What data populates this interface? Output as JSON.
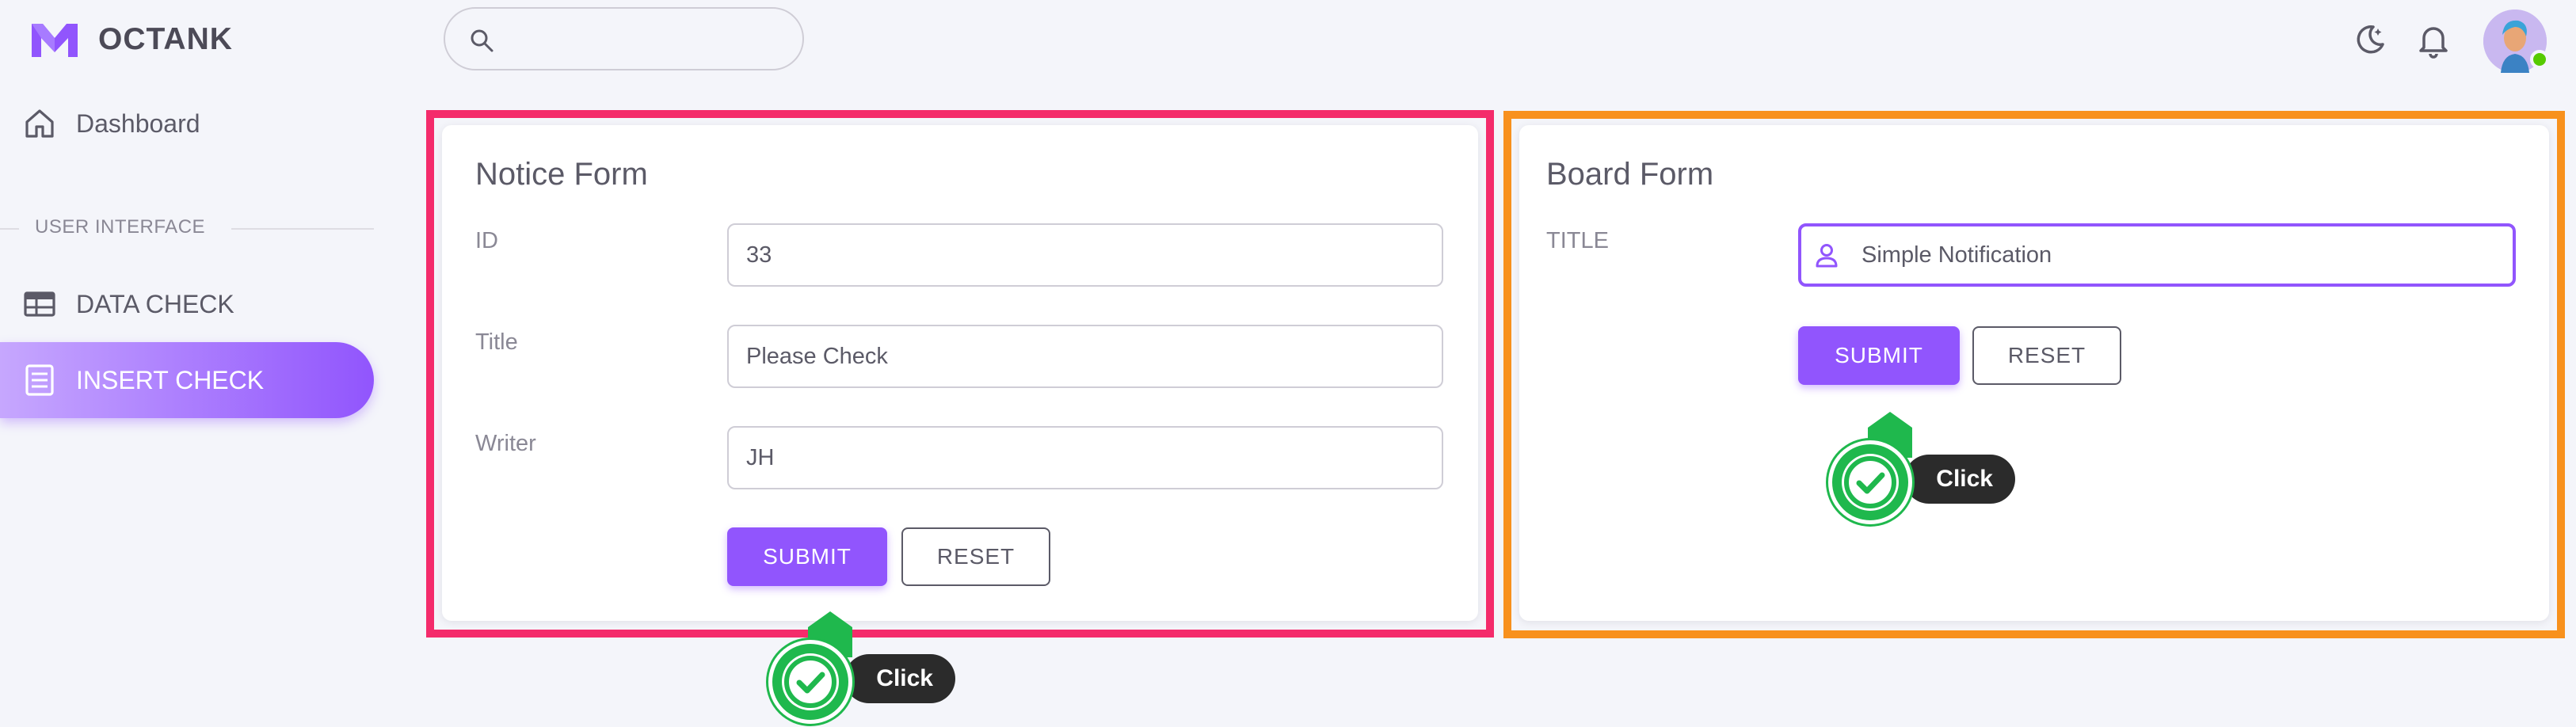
{
  "app": {
    "brand": "OCTANK",
    "brand_color": "#9155fd"
  },
  "header": {
    "search": {
      "placeholder": "",
      "value": ""
    },
    "icons": [
      "moon-star-icon",
      "bell-icon"
    ],
    "avatar_status_color": "#56ca00"
  },
  "sidebar": {
    "items": [
      {
        "label": "Dashboard",
        "icon": "home-icon"
      },
      {
        "label": "DATA CHECK",
        "icon": "table-icon"
      },
      {
        "label": "INSERT CHECK",
        "icon": "form-icon",
        "active": true
      }
    ],
    "section_label": "USER INTERFACE"
  },
  "notice_form": {
    "title": "Notice Form",
    "fields": [
      {
        "label": "ID",
        "value": "33"
      },
      {
        "label": "Title",
        "value": "Please Check"
      },
      {
        "label": "Writer",
        "value": "JH"
      }
    ],
    "submit_label": "SUBMIT",
    "reset_label": "RESET",
    "highlight_color": "#f42b6b"
  },
  "board_form": {
    "title": "Board Form",
    "fields": [
      {
        "label": "TITLE",
        "value": "Simple Notification",
        "icon": "user-icon"
      }
    ],
    "submit_label": "SUBMIT",
    "reset_label": "RESET",
    "highlight_color": "#f8911d"
  },
  "annotations": {
    "click_label": "Click",
    "click_color": "#1fb84d"
  }
}
